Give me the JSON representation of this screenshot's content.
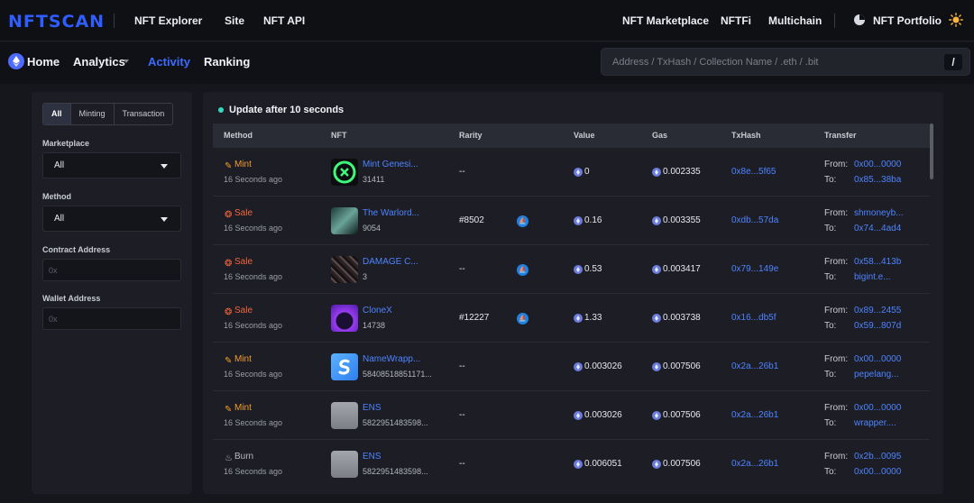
{
  "header": {
    "logo": "NFTSCAN",
    "links": [
      "NFT Explorer",
      "Site",
      "NFT API"
    ],
    "right_links": [
      "NFT Marketplace",
      "NFTFi",
      "Multichain"
    ],
    "portfolio": "NFT Portfolio"
  },
  "nav": {
    "home": "Home",
    "analytics": "Analytics",
    "activity": "Activity",
    "ranking": "Ranking",
    "search_placeholder": "Address / TxHash / Collection Name / .eth / .bit",
    "search_key": "/"
  },
  "filters": {
    "tabs": [
      "All",
      "Minting",
      "Transaction"
    ],
    "active_tab": "All",
    "marketplace_label": "Marketplace",
    "marketplace_value": "All",
    "method_label": "Method",
    "method_value": "All",
    "contract_label": "Contract Address",
    "contract_placeholder": "0x",
    "wallet_label": "Wallet Address",
    "wallet_placeholder": "0x"
  },
  "table": {
    "update_text": "Update after 10 seconds",
    "headers": [
      "Method",
      "NFT",
      "Rarity",
      "Value",
      "Gas",
      "TxHash",
      "Transfer"
    ],
    "from_label": "From:",
    "to_label": "To:",
    "rows": [
      {
        "method": "Mint",
        "time": "16 Seconds ago",
        "nft_name": "Mint Genesi...",
        "nft_id": "31411",
        "rarity": "--",
        "value": "0",
        "gas": "0.002335",
        "txhash": "0x8e...5f65",
        "from": "0x00...0000",
        "to": "0x85...38ba"
      },
      {
        "method": "Sale",
        "time": "16 Seconds ago",
        "nft_name": "The Warlord...",
        "nft_id": "9054",
        "rarity": "#8502",
        "value": "0.16",
        "gas": "0.003355",
        "txhash": "0xdb...57da",
        "from": "shmoneyb...",
        "to": "0x74...4ad4"
      },
      {
        "method": "Sale",
        "time": "16 Seconds ago",
        "nft_name": "DAMAGE C...",
        "nft_id": "3",
        "rarity": "--",
        "value": "0.53",
        "gas": "0.003417",
        "txhash": "0x79...149e",
        "from": "0x58...413b",
        "to": "bigint.e..."
      },
      {
        "method": "Sale",
        "time": "16 Seconds ago",
        "nft_name": "CloneX",
        "nft_id": "14738",
        "rarity": "#12227",
        "value": "1.33",
        "gas": "0.003738",
        "txhash": "0x16...db5f",
        "from": "0x89...2455",
        "to": "0x59...807d"
      },
      {
        "method": "Mint",
        "time": "16 Seconds ago",
        "nft_name": "NameWrapp...",
        "nft_id": "58408518851171...",
        "rarity": "--",
        "value": "0.003026",
        "gas": "0.007506",
        "txhash": "0x2a...26b1",
        "from": "0x00...0000",
        "to": "pepelang..."
      },
      {
        "method": "Mint",
        "time": "16 Seconds ago",
        "nft_name": "ENS",
        "nft_id": "5822951483598...",
        "rarity": "--",
        "value": "0.003026",
        "gas": "0.007506",
        "txhash": "0x2a...26b1",
        "from": "0x00...0000",
        "to": "wrapper...."
      },
      {
        "method": "Burn",
        "time": "16 Seconds ago",
        "nft_name": "ENS",
        "nft_id": "5822951483598...",
        "rarity": "--",
        "value": "0.006051",
        "gas": "0.007506",
        "txhash": "0x2a...26b1",
        "from": "0x2b...0095",
        "to": "0x00...0000"
      }
    ]
  }
}
